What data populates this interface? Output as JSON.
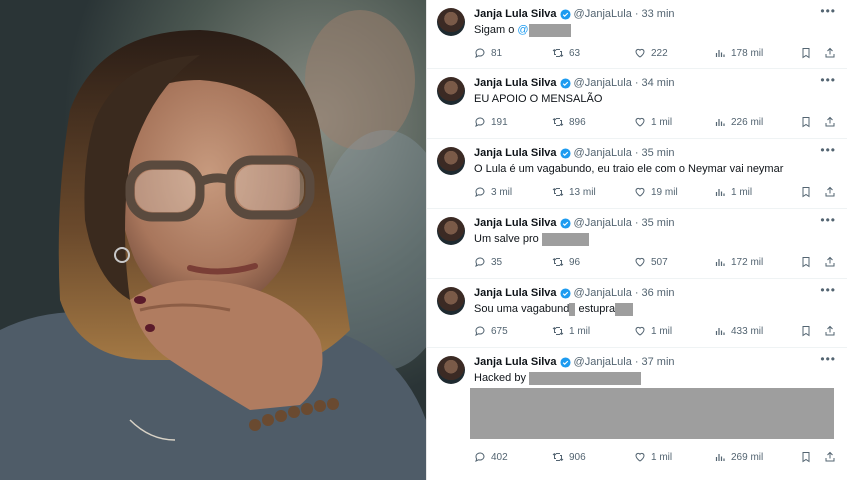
{
  "feed": {
    "tweets": [
      {
        "author": "Janja Lula Silva",
        "handle": "@JanjaLula",
        "time": "33 min",
        "text": "Sigam o",
        "mention": "@",
        "replies": "81",
        "retweets": "63",
        "likes": "222",
        "views": "178 mil"
      },
      {
        "author": "Janja Lula Silva",
        "handle": "@JanjaLula",
        "time": "34 min",
        "text": "EU APOIO O MENSALÃO",
        "replies": "191",
        "retweets": "896",
        "likes": "1 mil",
        "views": "226 mil"
      },
      {
        "author": "Janja Lula Silva",
        "handle": "@JanjaLula",
        "time": "35 min",
        "text": "O Lula é um vagabundo, eu traio ele com o Neymar vai neymar",
        "replies": "3 mil",
        "retweets": "13 mil",
        "likes": "19 mil",
        "views": "1 mil"
      },
      {
        "author": "Janja Lula Silva",
        "handle": "@JanjaLula",
        "time": "35 min",
        "text": "Um salve pro",
        "replies": "35",
        "retweets": "96",
        "likes": "507",
        "views": "172 mil"
      },
      {
        "author": "Janja Lula Silva",
        "handle": "@JanjaLula",
        "time": "36 min",
        "text_a": "Sou uma vagabund",
        "text_b": "estupra",
        "replies": "675",
        "retweets": "1 mil",
        "likes": "1 mil",
        "views": "433 mil"
      },
      {
        "author": "Janja Lula Silva",
        "handle": "@JanjaLula",
        "time": "37 min",
        "text": "Hacked by",
        "replies": "402",
        "retweets": "906",
        "likes": "1 mil",
        "views": "269 mil"
      }
    ],
    "more_icon": "•••",
    "separator": "·"
  },
  "colors": {
    "verified": "#1d9bf0",
    "redaction": "#9e9e9e",
    "secondary_text": "#536471"
  }
}
